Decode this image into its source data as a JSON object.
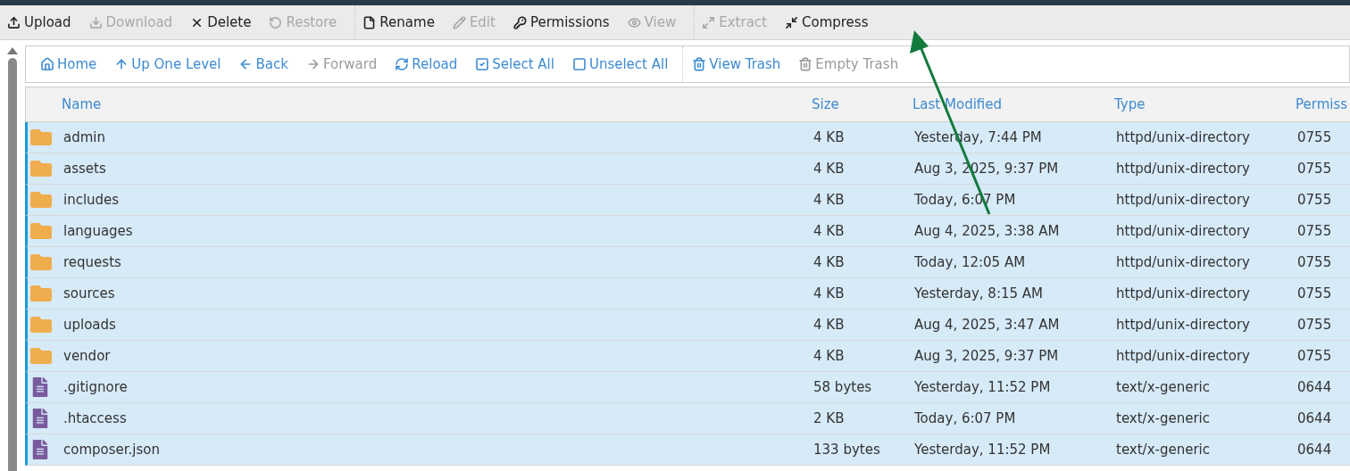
{
  "toolbar": {
    "groups": [
      {
        "items": [
          {
            "label": "Upload",
            "disabled": false
          },
          {
            "label": "Download",
            "disabled": true
          },
          {
            "label": "Delete",
            "disabled": false
          },
          {
            "label": "Restore",
            "disabled": true
          }
        ]
      },
      {
        "items": [
          {
            "label": "Rename",
            "disabled": false
          },
          {
            "label": "Edit",
            "disabled": true
          },
          {
            "label": "Permissions",
            "disabled": false
          },
          {
            "label": "View",
            "disabled": true
          }
        ]
      },
      {
        "items": [
          {
            "label": "Extract",
            "disabled": true
          },
          {
            "label": "Compress",
            "disabled": false
          }
        ]
      }
    ]
  },
  "navbar": {
    "groups": [
      {
        "items": [
          {
            "label": "Home",
            "disabled": false
          },
          {
            "label": "Up One Level",
            "disabled": false
          },
          {
            "label": "Back",
            "disabled": false
          },
          {
            "label": "Forward",
            "disabled": true
          },
          {
            "label": "Reload",
            "disabled": false
          },
          {
            "label": "Select All",
            "disabled": false
          },
          {
            "label": "Unselect All",
            "disabled": false
          }
        ]
      },
      {
        "items": [
          {
            "label": "View Trash",
            "disabled": false
          },
          {
            "label": "Empty Trash",
            "disabled": true
          }
        ]
      }
    ]
  },
  "table": {
    "columns": [
      "Name",
      "Size",
      "Last Modified",
      "Type",
      "Permiss"
    ],
    "rows": [
      {
        "kind": "folder",
        "selected": true,
        "cells": [
          "admin",
          "4 KB",
          "Yesterday, 7:44 PM",
          "httpd/unix-directory",
          "0755"
        ]
      },
      {
        "kind": "folder",
        "selected": true,
        "cells": [
          "assets",
          "4 KB",
          "Aug 3, 2025, 9:37 PM",
          "httpd/unix-directory",
          "0755"
        ]
      },
      {
        "kind": "folder",
        "selected": true,
        "cells": [
          "includes",
          "4 KB",
          "Today, 6:07 PM",
          "httpd/unix-directory",
          "0755"
        ]
      },
      {
        "kind": "folder",
        "selected": true,
        "cells": [
          "languages",
          "4 KB",
          "Aug 4, 2025, 3:38 AM",
          "httpd/unix-directory",
          "0755"
        ]
      },
      {
        "kind": "folder",
        "selected": true,
        "cells": [
          "requests",
          "4 KB",
          "Today, 12:05 AM",
          "httpd/unix-directory",
          "0755"
        ]
      },
      {
        "kind": "folder",
        "selected": true,
        "cells": [
          "sources",
          "4 KB",
          "Yesterday, 8:15 AM",
          "httpd/unix-directory",
          "0755"
        ]
      },
      {
        "kind": "folder",
        "selected": true,
        "cells": [
          "uploads",
          "4 KB",
          "Aug 4, 2025, 3:47 AM",
          "httpd/unix-directory",
          "0755"
        ]
      },
      {
        "kind": "folder",
        "selected": true,
        "cells": [
          "vendor",
          "4 KB",
          "Aug 3, 2025, 9:37 PM",
          "httpd/unix-directory",
          "0755"
        ]
      },
      {
        "kind": "file",
        "selected": true,
        "cells": [
          ".gitignore",
          "58 bytes",
          "Yesterday, 11:52 PM",
          "text/x-generic",
          "0644"
        ]
      },
      {
        "kind": "file",
        "selected": true,
        "cells": [
          ".htaccess",
          "2 KB",
          "Today, 6:07 PM",
          "text/x-generic",
          "0644"
        ]
      },
      {
        "kind": "file",
        "selected": true,
        "cells": [
          "composer.json",
          "133 bytes",
          "Yesterday, 11:52 PM",
          "text/x-generic",
          "0644"
        ]
      }
    ]
  },
  "annotation": {
    "kind": "arrow",
    "color": "#127a3c"
  }
}
